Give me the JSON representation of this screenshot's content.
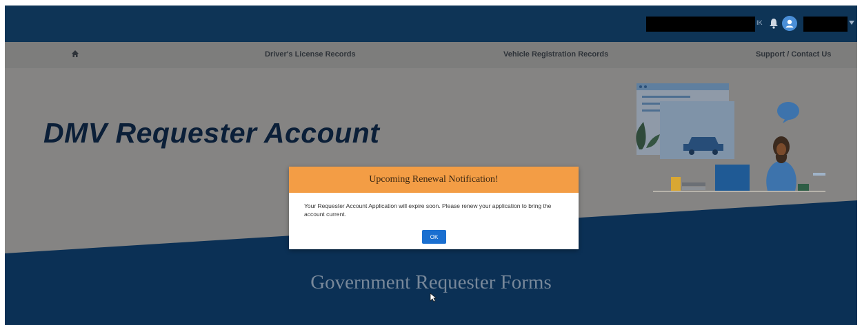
{
  "header": {
    "initials": "IK",
    "icons": [
      "bell-icon",
      "user-avatar-icon",
      "chevron-down-icon"
    ]
  },
  "nav": {
    "home_icon": "home-icon",
    "items": [
      {
        "label": "Driver's License Records"
      },
      {
        "label": "Vehicle Registration Records"
      },
      {
        "label": "Support / Contact Us"
      }
    ]
  },
  "hero": {
    "title": "DMV Requester Account"
  },
  "section": {
    "title": "Government Requester Forms"
  },
  "modal": {
    "title": "Upcoming Renewal Notification!",
    "message": "Your Requester Account Application will expire soon. Please renew your application to bring the account current.",
    "ok_label": "OK"
  },
  "colors": {
    "header_bg": "#0e3456",
    "nav_bg": "#7d7d7c",
    "hero_bg": "#858483",
    "modal_header": "#f39d45",
    "button": "#1a6fd0"
  }
}
